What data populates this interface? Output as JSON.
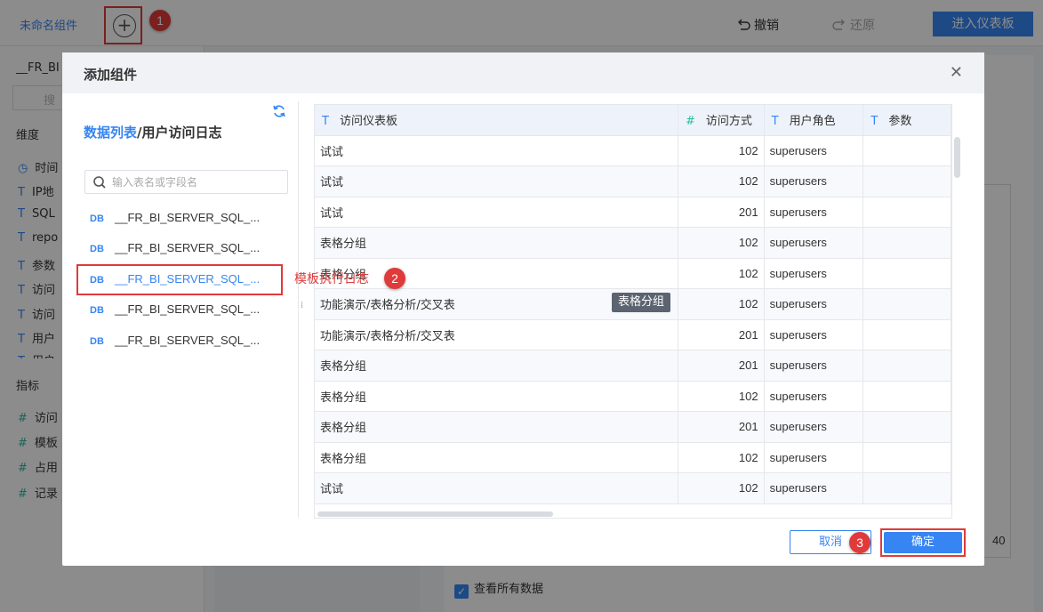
{
  "app": {
    "title": "未命名组件",
    "undo_label": "撤销",
    "redo_label": "还原",
    "enter_dashboard_label": "进入仪表板"
  },
  "annotations": [
    "1",
    "2",
    "3"
  ],
  "bg_left": {
    "table_name": "__FR_BI",
    "search_placeholder": "搜",
    "dimension_label": "维度",
    "dimension_fields": [
      "时间",
      "IP地",
      "SQL",
      "repo",
      "参数",
      "访问",
      "访问",
      "用户",
      "用户"
    ],
    "metric_label": "指标",
    "metric_fields": [
      "访问",
      "模板",
      "占用",
      "记录"
    ]
  },
  "bg_right": {
    "axis_value": "40",
    "view_all_label": "查看所有数据",
    "check_mark": "✓"
  },
  "dialog": {
    "title": "添加组件",
    "close_glyph": "✕",
    "breadcrumb_root": "数据列表",
    "breadcrumb_current": "/用户访问日志",
    "search_placeholder": "输入表名或字段名",
    "db_badge": "DB",
    "tables": [
      "__FR_BI_SERVER_SQL_...",
      "__FR_BI_SERVER_SQL_...",
      "__FR_BI_SERVER_SQL_...",
      "__FR_BI_SERVER_SQL_...",
      "__FR_BI_SERVER_SQL_..."
    ],
    "active_table_index": 2,
    "active_table_tooltip": "模板执行日志",
    "columns": [
      {
        "type_glyph": "T",
        "label": "访问仪表板"
      },
      {
        "type_glyph": "#",
        "label": "访问方式"
      },
      {
        "type_glyph": "T",
        "label": "用户角色"
      },
      {
        "type_glyph": "T",
        "label": "参数"
      }
    ],
    "rows": [
      [
        "试试",
        "102",
        "superusers",
        ""
      ],
      [
        "试试",
        "102",
        "superusers",
        ""
      ],
      [
        "试试",
        "201",
        "superusers",
        ""
      ],
      [
        "表格分组",
        "102",
        "superusers",
        ""
      ],
      [
        "表格分组",
        "102",
        "superusers",
        ""
      ],
      [
        "功能演示/表格分析/交叉表",
        "102",
        "superusers",
        ""
      ],
      [
        "功能演示/表格分析/交叉表",
        "201",
        "superusers",
        ""
      ],
      [
        "表格分组",
        "201",
        "superusers",
        ""
      ],
      [
        "表格分组",
        "102",
        "superusers",
        ""
      ],
      [
        "表格分组",
        "201",
        "superusers",
        ""
      ],
      [
        "表格分组",
        "102",
        "superusers",
        ""
      ],
      [
        "试试",
        "102",
        "superusers",
        ""
      ]
    ],
    "cell_tooltip": "表格分组",
    "cancel_label": "取消",
    "ok_label": "确定"
  },
  "colors": {
    "accent": "#3685f2",
    "annotation_red": "#e03a3a",
    "number_type": "#2fbba1"
  }
}
